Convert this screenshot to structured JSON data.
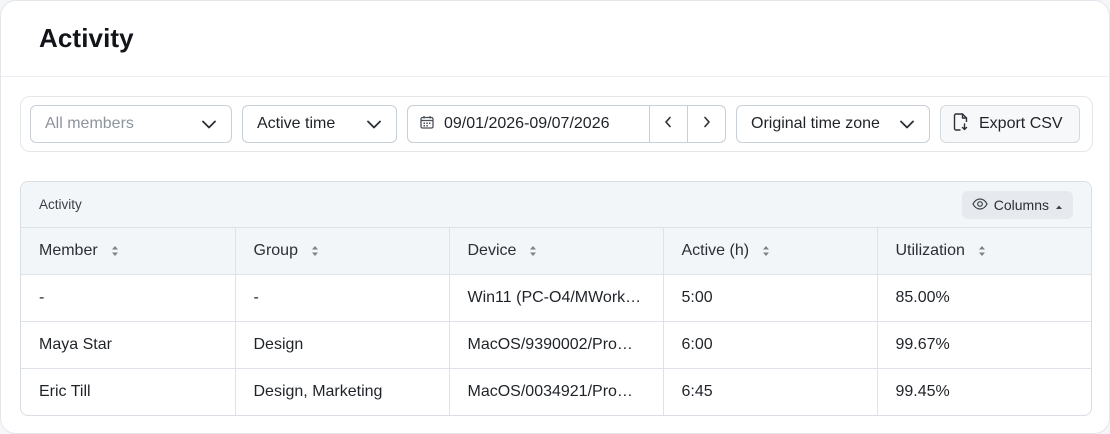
{
  "page": {
    "title": "Activity"
  },
  "filters": {
    "members_placeholder": "All members",
    "metric": "Active time",
    "date_range": "09/01/2026-09/07/2026",
    "timezone": "Original time zone",
    "export_label": "Export CSV"
  },
  "table": {
    "title": "Activity",
    "columns_button": "Columns",
    "headers": [
      "Member",
      "Group",
      "Device",
      "Active (h)",
      "Utilization"
    ],
    "rows": [
      [
        "-",
        "-",
        "Win11 (PC-O4/MWork…",
        "5:00",
        "85.00%"
      ],
      [
        "Maya Star",
        "Design",
        "MacOS/9390002/Pro…",
        "6:00",
        "99.67%"
      ],
      [
        "Eric Till",
        "Design, Marketing",
        "MacOS/0034921/Pro…",
        "6:45",
        "99.45%"
      ]
    ]
  },
  "icons": {
    "chevron": "chevron-down-icon",
    "calendar": "calendar-icon",
    "prev": "chevron-left-icon",
    "next": "chevron-right-icon",
    "export": "file-export-icon",
    "eye": "eye-icon",
    "caret_up": "caret-up-icon",
    "sort": "sort-icon"
  },
  "colors": {
    "text": "#1f2328",
    "muted": "#8c949c",
    "header_bg": "#f3f6f8",
    "border": "#dde3e8"
  }
}
